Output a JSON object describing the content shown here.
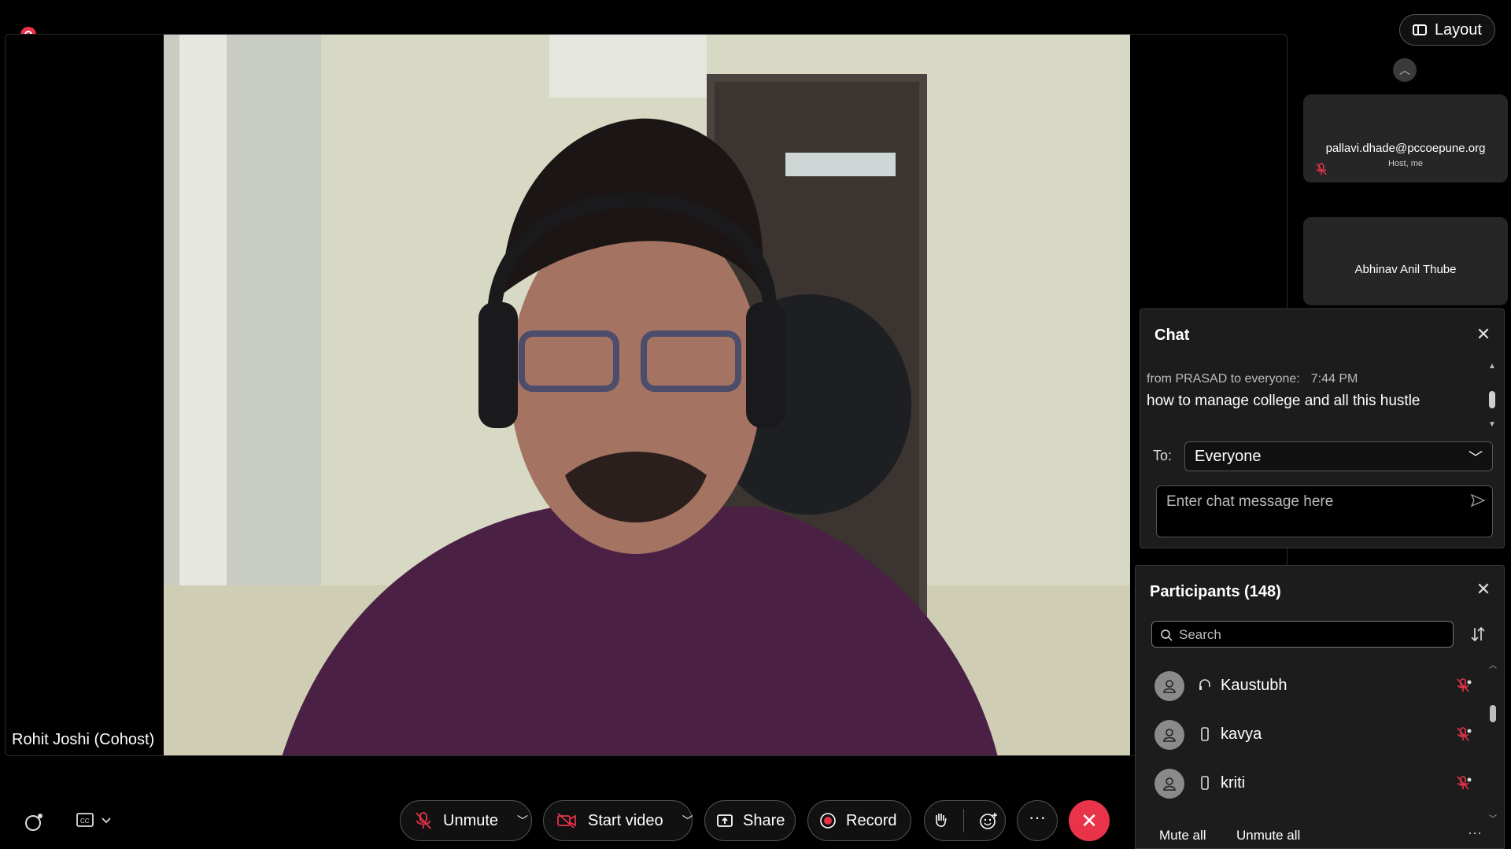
{
  "main_video": {
    "participant_name": "Rohit Joshi (Cohost)"
  },
  "layout_button": {
    "label": "Layout"
  },
  "thumbnails": [
    {
      "name": "pallavi.dhade@pccoepune.org",
      "subtitle": "Host, me"
    },
    {
      "name": "Abhinav Anil Thube",
      "subtitle": ""
    }
  ],
  "chat": {
    "title": "Chat",
    "messages": [
      {
        "meta": "from PRASAD to everyone:",
        "time": "7:44 PM",
        "text": "how to manage college and all this hustle"
      }
    ],
    "to_label": "To:",
    "recipient": "Everyone",
    "input_placeholder": "Enter chat message here"
  },
  "participants": {
    "title": "Participants (148)",
    "search_placeholder": "Search",
    "list": [
      {
        "name": "Kaustubh",
        "device": "headset-icon"
      },
      {
        "name": "kavya",
        "device": "phone-icon"
      },
      {
        "name": "kriti",
        "device": "phone-icon"
      }
    ],
    "mute_all": "Mute all",
    "unmute_all": "Unmute all",
    "more": "···"
  },
  "controls": {
    "unmute": "Unmute",
    "start_video": "Start video",
    "share": "Share",
    "record": "Record",
    "more": "···",
    "leave": "✕"
  },
  "colors": {
    "accent_red": "#e8334a",
    "panel_bg": "#1c1c1c",
    "background": "#000000"
  }
}
